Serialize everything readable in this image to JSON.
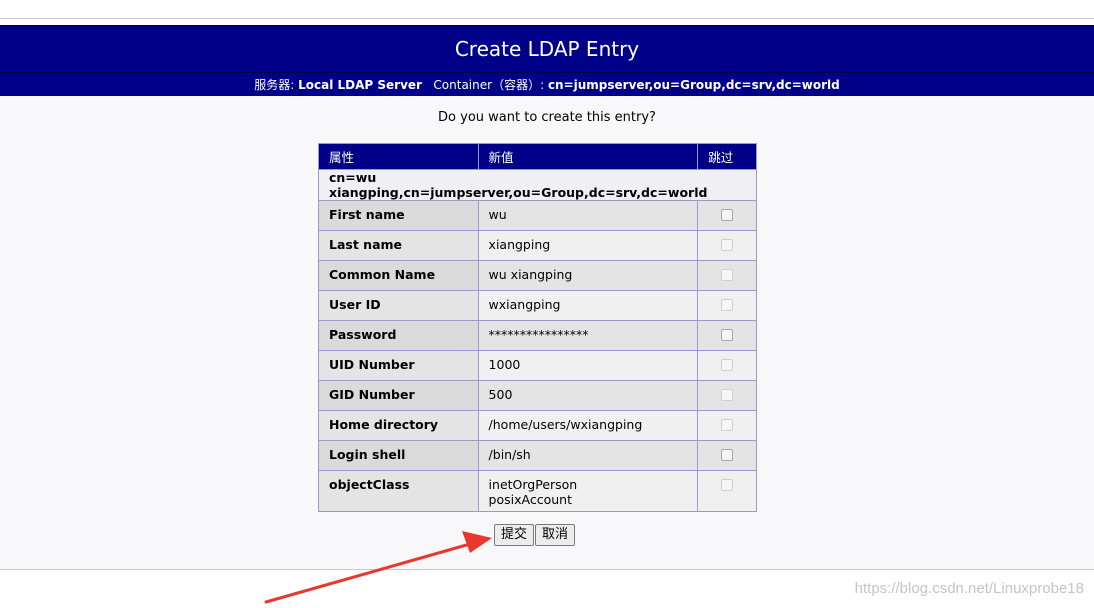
{
  "header": {
    "title": "Create LDAP Entry",
    "server_label": "服务器:",
    "server_name": "Local LDAP Server",
    "container_label": "Container（容器）:",
    "container_dn": "cn=jumpserver,ou=Group,dc=srv,dc=world"
  },
  "question": "Do you want to create this entry?",
  "table": {
    "headers": {
      "attribute": "属性",
      "new_value": "新值",
      "skip": "跳过"
    },
    "dn": "cn=wu xiangping,cn=jumpserver,ou=Group,dc=srv,dc=world",
    "rows": [
      {
        "name": "First name",
        "value": "wu",
        "skip_enabled": true
      },
      {
        "name": "Last name",
        "value": "xiangping",
        "skip_enabled": false
      },
      {
        "name": "Common Name",
        "value": "wu xiangping",
        "skip_enabled": false
      },
      {
        "name": "User ID",
        "value": "wxiangping",
        "skip_enabled": false
      },
      {
        "name": "Password",
        "value": "****************",
        "skip_enabled": true
      },
      {
        "name": "UID Number",
        "value": "1000",
        "skip_enabled": false
      },
      {
        "name": "GID Number",
        "value": "500",
        "skip_enabled": false
      },
      {
        "name": "Home directory",
        "value": "/home/users/wxiangping",
        "skip_enabled": false
      },
      {
        "name": "Login shell",
        "value": "/bin/sh",
        "skip_enabled": true
      },
      {
        "name": "objectClass",
        "value": "inetOrgPerson",
        "value2": "posixAccount",
        "skip_enabled": false
      }
    ]
  },
  "buttons": {
    "submit": "提交",
    "cancel": "取消"
  },
  "watermark": "https://blog.csdn.net/Linuxprobe18",
  "colors": {
    "header_bg": "#000088",
    "arrow": "#e8372c"
  }
}
